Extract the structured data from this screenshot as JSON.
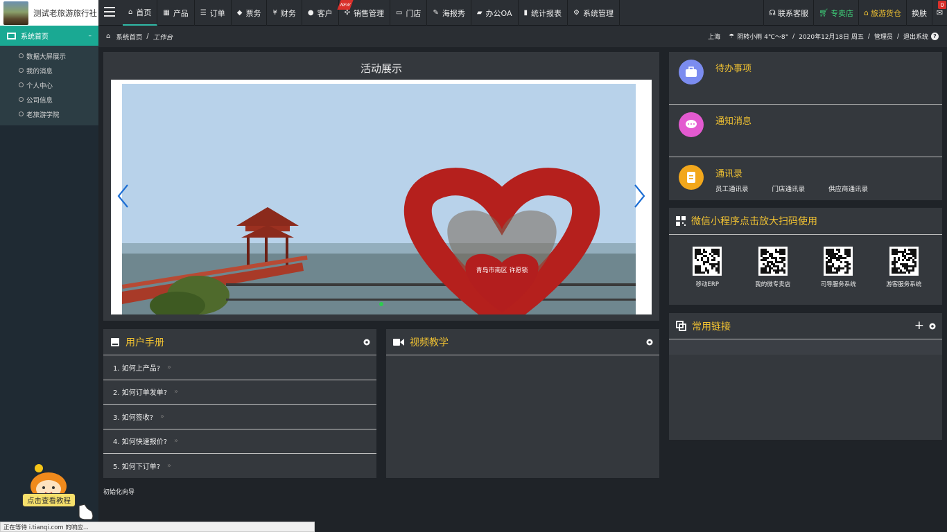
{
  "brand": {
    "name": "测试老旅游旅行社"
  },
  "nav": [
    {
      "label": "首页",
      "icon": "home-icon",
      "active": true
    },
    {
      "label": "产品",
      "icon": "grid-icon"
    },
    {
      "label": "订单",
      "icon": "list-icon"
    },
    {
      "label": "票务",
      "icon": "ticket-icon"
    },
    {
      "label": "财务",
      "icon": "yen-icon"
    },
    {
      "label": "客户",
      "icon": "user-icon"
    },
    {
      "label": "销售管理",
      "icon": "expand-icon",
      "badge": "NEW"
    },
    {
      "label": "门店",
      "icon": "store-icon"
    },
    {
      "label": "海报秀",
      "icon": "brush-icon"
    },
    {
      "label": "办公OA",
      "icon": "folder-icon"
    },
    {
      "label": "统计报表",
      "icon": "chart-icon"
    },
    {
      "label": "系统管理",
      "icon": "gears-icon"
    }
  ],
  "right_tools": {
    "contact": "联系客服",
    "shop": "专卖店",
    "supply": "旅游货仓",
    "skin": "换肤",
    "mail_count": "0"
  },
  "sidebar": {
    "head": "系统首页",
    "items": [
      "数据大屏展示",
      "我的消息",
      "个人中心",
      "公司信息",
      "老旅游学院"
    ]
  },
  "breadcrumb": {
    "home": "系统首页",
    "current": "工作台",
    "city": "上海",
    "weather": "阴转小雨 4℃～8°",
    "date": "2020年12月18日 周五",
    "role": "管理员",
    "logout": "退出系统"
  },
  "carousel": {
    "title": "活动展示",
    "sign_text": "青岛市南区 许愿锁"
  },
  "manual": {
    "title": "用户手册",
    "items": [
      "1. 如何上产品?",
      "2. 如何订单发单?",
      "3. 如何签收?",
      "4. 如何快速报价?",
      "5. 如何下订单?"
    ],
    "arrow": "»"
  },
  "video": {
    "title": "视频教学"
  },
  "init_guide": "初始化向导",
  "todo": {
    "pending_title": "待办事项",
    "notice_title": "通知消息",
    "contacts_title": "通讯录",
    "contacts_links": [
      "员工通讯录",
      "门店通讯录",
      "供应商通讯录"
    ]
  },
  "qr": {
    "title": "微信小程序点击放大扫码使用",
    "items": [
      "移动ERP",
      "我的微专卖店",
      "司导服务系统",
      "游客服务系统"
    ]
  },
  "links": {
    "title": "常用链接",
    "add": "+"
  },
  "mascot": {
    "label": "点击查看教程"
  },
  "status": "正在等待 i.tianqi.com 的响应...",
  "colors": {
    "accent": "#1aa993",
    "gold": "#f1c232",
    "green": "#3fd47b",
    "badge": "#d9302b"
  }
}
